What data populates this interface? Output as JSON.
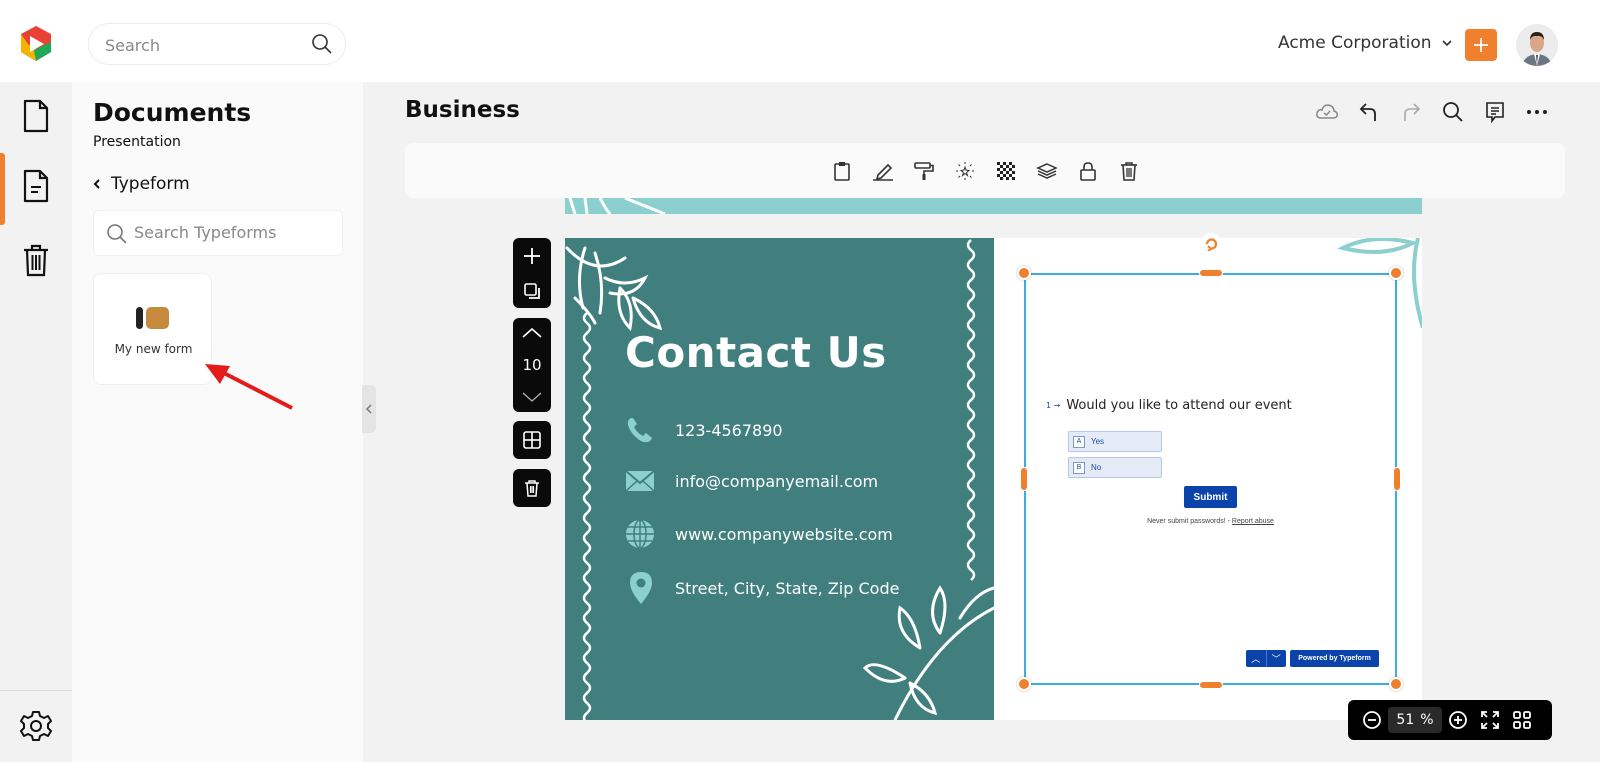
{
  "topbar": {
    "search_placeholder": "Search",
    "organization": "Acme Corporation",
    "add_label": "+",
    "accent_color": "#f07f2e"
  },
  "rail": {
    "items": [
      {
        "name": "documents",
        "icon": "file-icon"
      },
      {
        "name": "pages",
        "icon": "file-text-icon",
        "active": true
      },
      {
        "name": "trash",
        "icon": "trash-icon"
      }
    ],
    "settings_icon": "gear-icon"
  },
  "panel": {
    "title": "Documents",
    "subtitle": "Presentation",
    "back_label": "Typeform",
    "search_placeholder": "Search Typeforms",
    "forms": [
      {
        "label": "My new form",
        "icon": "typeform-icon"
      }
    ]
  },
  "main": {
    "title": "Business",
    "header_icons": [
      "cloud-saved-icon",
      "undo-icon",
      "redo-icon",
      "search-icon",
      "comment-icon",
      "more-icon"
    ],
    "toolbar_icons": [
      "clipboard-icon",
      "pencil-icon",
      "paint-roller-icon",
      "sparkle-icon",
      "transparency-icon",
      "layers-icon",
      "lock-icon",
      "trash-icon"
    ]
  },
  "slide_tools": {
    "page_number": "10"
  },
  "slide": {
    "title": "Contact Us",
    "bg_color": "#417f7f",
    "accent_color": "#8bcfcf",
    "contacts": [
      {
        "icon": "phone-icon",
        "text": "123-4567890"
      },
      {
        "icon": "mail-icon",
        "text": "info@companyemail.com"
      },
      {
        "icon": "globe-icon",
        "text": "www.companywebsite.com"
      },
      {
        "icon": "location-pin-icon",
        "text": "Street, City, State, Zip Code"
      }
    ]
  },
  "typeform": {
    "question_number": "1",
    "question": "Would you like to attend our event",
    "options": [
      {
        "key": "A",
        "label": "Yes"
      },
      {
        "key": "B",
        "label": "No"
      }
    ],
    "submit_label": "Submit",
    "note_text": "Never submit passwords! - ",
    "note_link": "Report abuse",
    "powered_by": "Powered by Typeform"
  },
  "zoom": {
    "value": "51",
    "unit": "%"
  }
}
